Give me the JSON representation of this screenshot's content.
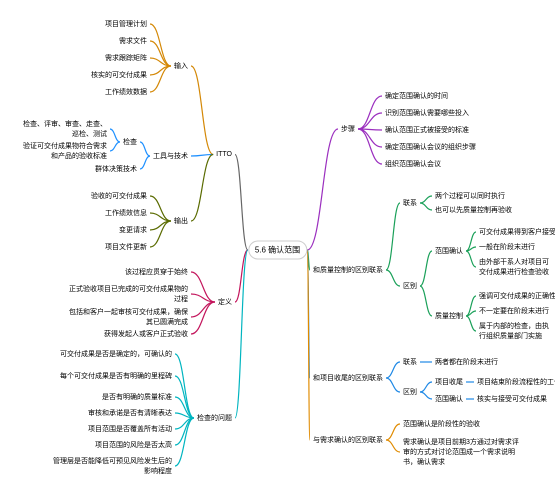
{
  "root": "5.6 确认范围",
  "left": {
    "itto": {
      "label": "ITTO",
      "inputs": {
        "label": "输入",
        "items": [
          "项目管理计划",
          "需求文件",
          "需求跟踪矩阵",
          "核实的可交付成果",
          "工作绩效数据"
        ]
      },
      "inspect": {
        "label": "检查",
        "parent": "工具与技术",
        "items": [
          "检查、评审、审查、走查、巡检、测试",
          "验证可交付成果物符合需求和产品的验收标准",
          "群体决策技术"
        ]
      },
      "outputs": {
        "label": "输出",
        "items": [
          "验收的可交付成果",
          "工作绩效信息",
          "变更请求",
          "项目文件更新"
        ]
      }
    },
    "definition": {
      "label": "定义",
      "items": [
        "该过程应贯穿于始终",
        "正式验收项目已完成的可交付成果物的过程",
        "包括和客户一起审核可交付成果，确保其已圆满完成",
        "获得发起人或客户正式验收"
      ]
    },
    "checkq": {
      "label": "检查的问题",
      "items": [
        "可交付成果是否是确定的，可确认的",
        "每个可交付成果是否有明确的里程碑",
        "是否有明确的质量标准",
        "审核和承诺是否有清晰表达",
        "项目范围是否覆盖所有活动",
        "项目范围的风险是否太高",
        "管理层是否能降低可预见风险发生后的影响程度"
      ]
    }
  },
  "right": {
    "steps": {
      "label": "步骤",
      "items": [
        "确定范围确认的时间",
        "识别范围确认需要哪些投入",
        "确认范围正式被接受的标准",
        "确定范围确认会议的组织步骤",
        "组织范围确认会议"
      ]
    },
    "quality": {
      "label": "和质量控制的区别联系",
      "contact": {
        "label": "联系",
        "items": [
          "两个过程可以同时执行",
          "也可以先质量控制再验收"
        ]
      },
      "diff": {
        "label": "区别",
        "confirm": {
          "label": "范围确认",
          "items": [
            "可交付成果得到客户接受",
            "一般在阶段末进行",
            "由外部干系人对项目可交付成果进行检查验收"
          ]
        },
        "qc": {
          "label": "质量控制",
          "items": [
            "强调可交付成果的正确性",
            "不一定要在阶段末进行",
            "属于内部的检查，由执行组织质量部门实施"
          ]
        }
      }
    },
    "close": {
      "label": "和项目收尾的区别联系",
      "contact": {
        "label": "联系",
        "items": [
          "两者都在阶段末进行"
        ]
      },
      "diff": {
        "label": "区别",
        "items": [
          {
            "k": "项目收尾",
            "v": "项目结束阶段流程性的工作"
          },
          {
            "k": "范围确认",
            "v": "核实与接受可交付成果"
          }
        ]
      }
    },
    "req": {
      "label": "与需求确认的区别联系",
      "items": [
        "范围确认是阶段性的验收",
        "需求确认是项目前期3方通过对需求评审的方式对讨论范围成一个需求说明书，确认需求"
      ]
    }
  },
  "colors": {
    "root": "#666666",
    "inputs": "#d48806",
    "inspect": "#1e90ff",
    "outputs": "#5a6b00",
    "definition": "#c3155c",
    "checkq": "#00b5c0",
    "steps": "#9b2fbf",
    "quality": "#1aa059",
    "close": "#1e88e5",
    "req": "#e08b00"
  }
}
